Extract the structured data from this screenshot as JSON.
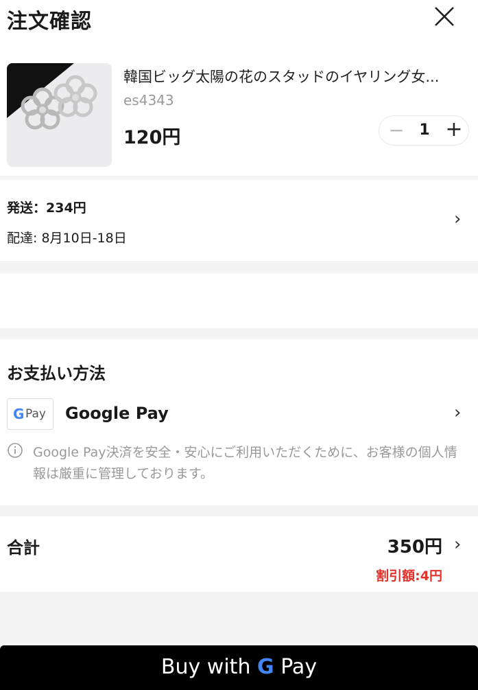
{
  "header": {
    "title": "注文確認",
    "close_icon": "close-icon"
  },
  "product": {
    "name": "韓国ビッグ太陽の花のスタッドのイヤリング女...",
    "sku": "es4343",
    "price": "120円",
    "quantity": "1",
    "minus_label": "−",
    "plus_label": "+",
    "image": "flower-earrings-image"
  },
  "shipping": {
    "fee": "発送：234円",
    "delivery": "配達: 8月10日-18日",
    "chevron": "›"
  },
  "payment": {
    "title": "お支払い方法",
    "method_name": "Google Pay",
    "badge_g": "G",
    "badge_pay": "Pay",
    "notice": "Google Pay決済を安全・安心にご利用いただくために、お客様の個人情報は厳重に管理しております。",
    "chevron": "›"
  },
  "total": {
    "label": "合計",
    "amount": "350円",
    "discount": "割引額:4円",
    "chevron": "›"
  },
  "buy_button": {
    "prefix": "Buy with",
    "g": "G",
    "suffix": "Pay"
  },
  "colors": {
    "accent_red": "#e0312b",
    "google_blue": "#4285F4",
    "button_bg": "#000000",
    "section_gap": "#f4f4f4"
  }
}
